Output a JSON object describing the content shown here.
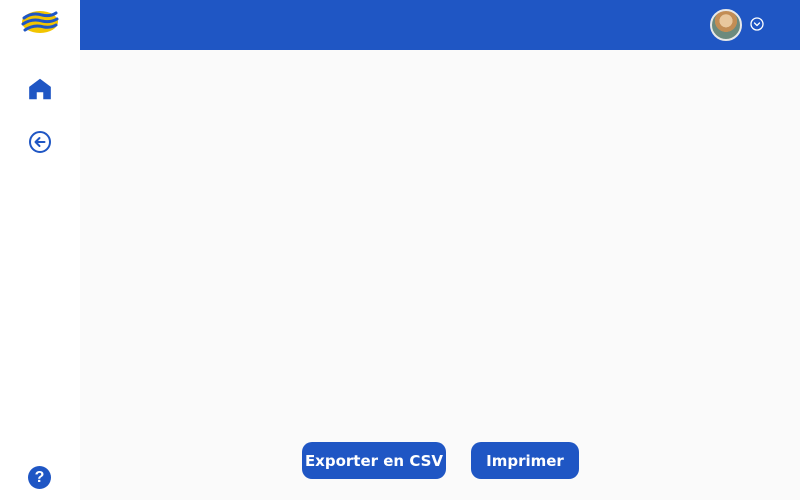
{
  "theme": {
    "accent": "#1f56c4",
    "sidebar_bg": "#ffffff",
    "content_bg": "#fafafa",
    "logo_colors": [
      "#f2c500",
      "#1f56c4"
    ]
  },
  "sidebar": {
    "logo": "brand-logo",
    "items": [
      {
        "icon": "home-icon"
      },
      {
        "icon": "arrow-left-circle-icon"
      }
    ],
    "help": {
      "icon": "help-icon",
      "label": "?"
    }
  },
  "topbar": {
    "user_menu": {
      "avatar": "avatar",
      "icon": "chevron-down-circle-icon"
    }
  },
  "actions": {
    "export_csv_label": "Exporter en CSV",
    "print_label": "Imprimer"
  }
}
